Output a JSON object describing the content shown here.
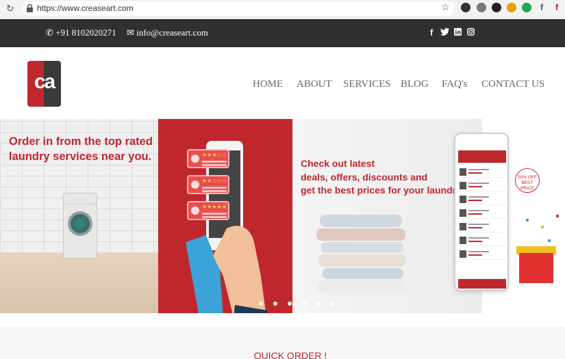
{
  "browser": {
    "url": "https://www.creaseart.com",
    "extensions": [
      "extension-1",
      "extension-2",
      "extension-3",
      "extension-4",
      "extension-5",
      "extension-6",
      "extension-7"
    ]
  },
  "topbar": {
    "phone": "+91 8102020271",
    "email": "info@creaseart.com",
    "social": [
      "facebook-icon",
      "twitter-icon",
      "linkedin-icon",
      "instagram-icon"
    ]
  },
  "header": {
    "logo_text": "ca",
    "nav": [
      "HOME",
      "ABOUT",
      "SERVICES",
      "BLOG",
      "FAQ's",
      "CONTACT US"
    ]
  },
  "slider": {
    "slide1_line1": "Order in from the top rated",
    "slide1_line2": "laundry services near you.",
    "slide3_line1": "Check out latest",
    "slide3_line2": "deals, offers, discounts and",
    "slide3_line3": "get the best prices for your laundry.",
    "offer_line1": "50% OFF",
    "offer_line2": "BEST PRICE",
    "dot_count": 6
  },
  "quick_order": {
    "title": "QUICK ORDER !"
  },
  "colors": {
    "brand_red": "#c0272d",
    "topbar": "#303030"
  }
}
